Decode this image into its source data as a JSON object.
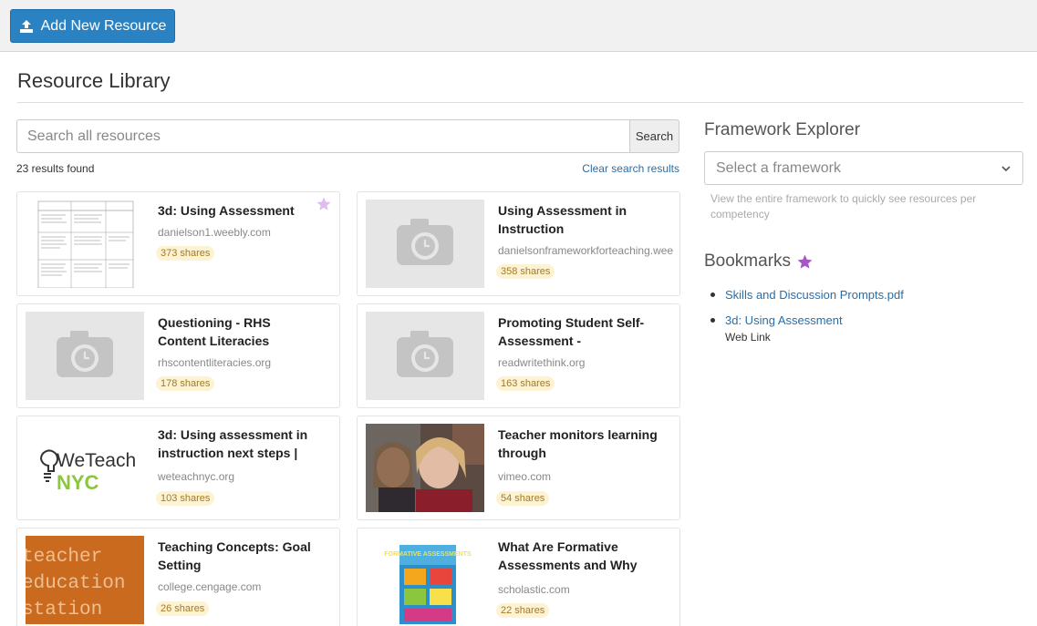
{
  "toolbar": {
    "add_label": "Add New Resource"
  },
  "page": {
    "title": "Resource Library"
  },
  "search": {
    "placeholder": "Search all resources",
    "button": "Search",
    "results": "23 results found",
    "clear": "Clear search results"
  },
  "cards": [
    {
      "title": "3d: Using Assessment",
      "domain": "danielson1.weebly.com",
      "shares": "373 shares",
      "thumb": "document",
      "bookmarked": true
    },
    {
      "title": "Using Assessment in Instruction",
      "domain": "danielsonframeworkforteaching.weebly.com",
      "shares": "358 shares",
      "thumb": "placeholder"
    },
    {
      "title": "Questioning - RHS Content Literacies",
      "domain": "rhscontentliteracies.org",
      "shares": "178 shares",
      "thumb": "placeholder"
    },
    {
      "title": "Promoting Student Self-Assessment -",
      "domain": "readwritethink.org",
      "shares": "163 shares",
      "thumb": "placeholder"
    },
    {
      "title": "3d: Using assessment in instruction next steps |",
      "domain": "weteachnyc.org",
      "shares": "103 shares",
      "thumb": "weteach"
    },
    {
      "title": "Teacher monitors learning through",
      "domain": "vimeo.com",
      "shares": "54 shares",
      "thumb": "photo"
    },
    {
      "title": "Teaching Concepts: Goal Setting",
      "domain": "college.cengage.com",
      "shares": "26 shares",
      "thumb": "teacher-ed"
    },
    {
      "title": "What Are Formative Assessments and Why",
      "domain": "scholastic.com",
      "shares": "22 shares",
      "thumb": "book"
    }
  ],
  "framework": {
    "title": "Framework Explorer",
    "select_placeholder": "Select a framework",
    "help": "View the entire framework to quickly see resources per competency"
  },
  "bookmarks": {
    "title": "Bookmarks",
    "items": [
      {
        "label": "Skills and Discussion Prompts.pdf",
        "sub": ""
      },
      {
        "label": "3d: Using Assessment",
        "sub": "Web Link"
      }
    ]
  },
  "thumb_text": {
    "weteach_top": "WeTeach",
    "weteach_bottom": "NYC",
    "teacher_ed": [
      "teacher",
      "education",
      "station"
    ],
    "book_title": "FORMATIVE ASSESSMENTS"
  },
  "colors": {
    "primary": "#2a82c2",
    "link": "#2a6ea8",
    "star": "#a855c9",
    "shares_bg": "#fdf2d2"
  }
}
